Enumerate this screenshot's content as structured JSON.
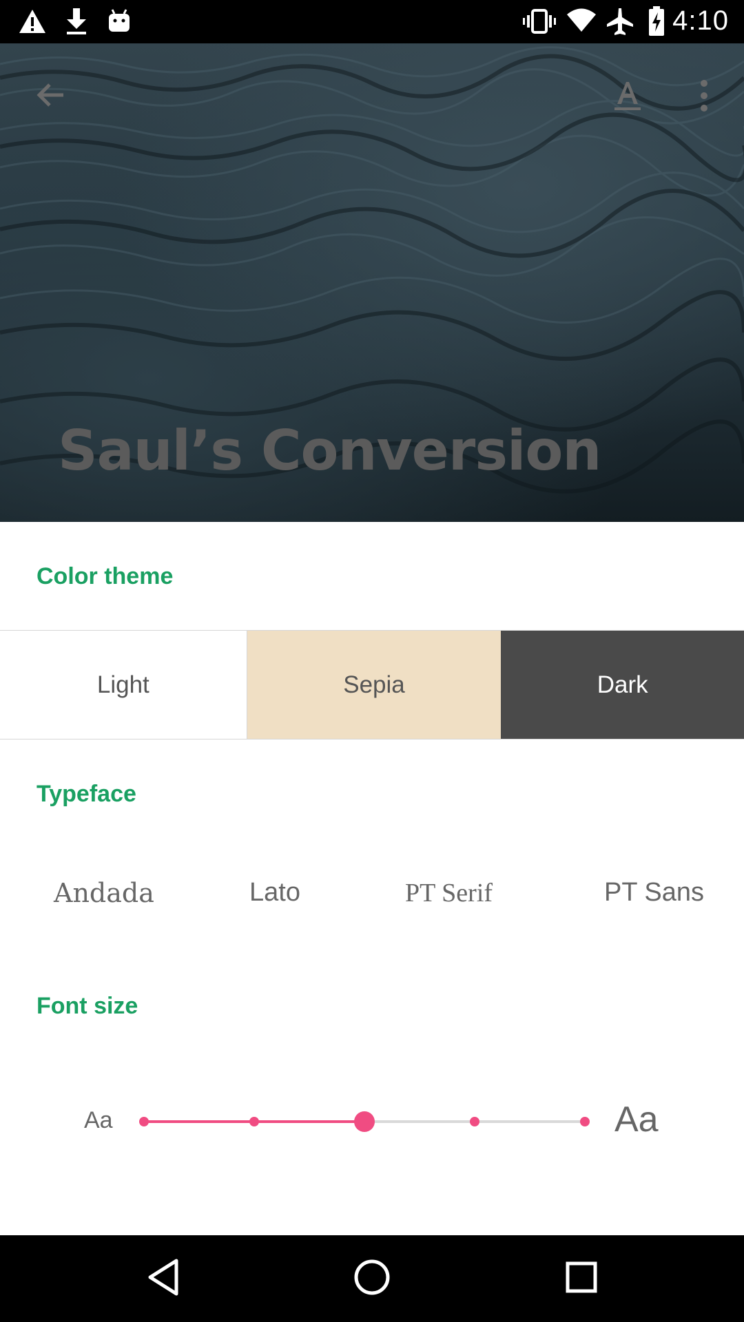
{
  "status_bar": {
    "time": "4:10",
    "left_icons": [
      "warning-icon",
      "download-icon",
      "android-icon"
    ],
    "right_icons": [
      "vibrate-icon",
      "wifi-icon",
      "airplane-icon",
      "battery-charging-icon"
    ]
  },
  "header": {
    "title": "Saul’s Conversion",
    "back_icon": "back-arrow-icon",
    "text_format_icon": "text-format-icon",
    "overflow_icon": "more-vert-icon"
  },
  "color_theme": {
    "label": "Color theme",
    "options": [
      {
        "label": "Light",
        "color": "#ffffff"
      },
      {
        "label": "Sepia",
        "color": "#f0dfc4"
      },
      {
        "label": "Dark",
        "color": "#4a4a4a"
      }
    ]
  },
  "typeface": {
    "label": "Typeface",
    "options": [
      "Andada",
      "Lato",
      "PT Serif",
      "PT Sans"
    ]
  },
  "font_size": {
    "label": "Font size",
    "small_label": "Aa",
    "large_label": "Aa",
    "steps": 5,
    "selected_step": 3,
    "accent_color": "#f04c82"
  },
  "colors": {
    "section_label": "#1aa062",
    "accent": "#f04c82"
  },
  "nav_bar": {
    "icons": [
      "back-triangle-icon",
      "home-circle-icon",
      "recents-square-icon"
    ]
  }
}
